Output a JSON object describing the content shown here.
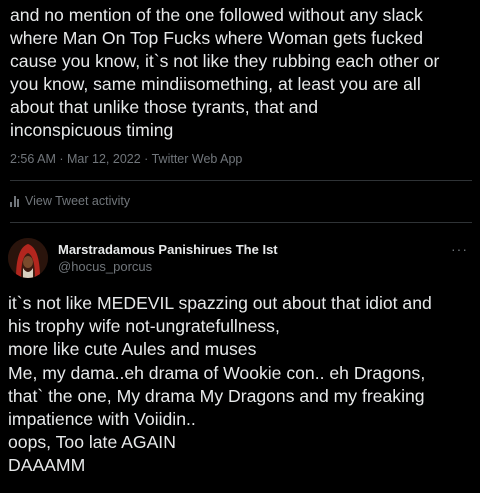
{
  "tweet": {
    "text": "and no mention of the one followed without any slack\nwhere Man On Top Fucks where Woman gets fucked\ncause you know, it`s not like they rubbing each other or\nyou know, same mindiisomething, at least you are all\nabout that unlike those tyrants, that and\ninconspicuous timing",
    "time": "2:56 AM",
    "separator": "·",
    "date": "Mar 12, 2022",
    "source": "Twitter Web App"
  },
  "activity": {
    "icon": "analytics-bars-icon",
    "label": "View Tweet activity"
  },
  "reply": {
    "author_name": "Marstradamous Panishirues The Ist",
    "author_handle": "@hocus_porcus",
    "more_icon": "more-dots-icon",
    "text": "it`s not like MEDEVIL spazzing out about that idiot and\nhis trophy wife not-ungratefullness,\nmore like cute Aules and muses\nMe, my dama..eh drama of Wookie con.. eh Dragons,\nthat` the one, My drama My Dragons and my freaking\nimpatience with Voiidin..\noops, Too late AGAIN\nDAAAMM"
  },
  "colors": {
    "background": "#000000",
    "text": "#e7e9ea",
    "secondary": "#71767b",
    "divider": "#2f3336",
    "avatar_hood": "#b3261e"
  }
}
